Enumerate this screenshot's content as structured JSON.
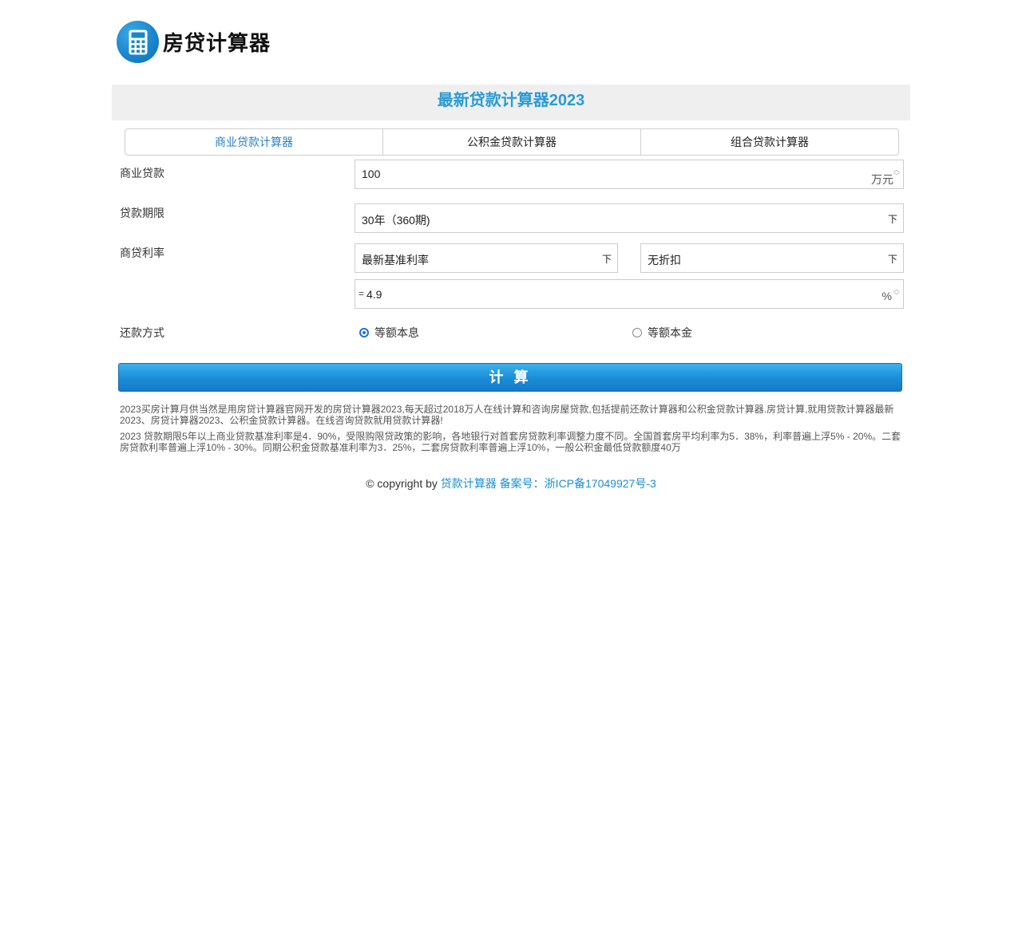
{
  "header": {
    "logo_icon": "calculator-icon",
    "site_title": "房贷计算器"
  },
  "banner": {
    "title": "最新贷款计算器2023"
  },
  "tabs": [
    {
      "label": "商业贷款计算器",
      "active": true
    },
    {
      "label": "公积金贷款计算器",
      "active": false
    },
    {
      "label": "组合贷款计算器",
      "active": false
    }
  ],
  "form": {
    "loan_amount": {
      "label": "商业贷款",
      "value": "100",
      "unit": "万元"
    },
    "loan_term": {
      "label": "贷款期限",
      "value": "30年（360期)",
      "arrow": "下"
    },
    "rate": {
      "label": "商贷利率",
      "rate_type": {
        "value": "最新基准利率",
        "arrow": "下"
      },
      "discount": {
        "value": "无折扣",
        "arrow": "下"
      },
      "prefix": "=",
      "value": "4.9",
      "unit": "%"
    },
    "repayment": {
      "label": "还款方式",
      "options": [
        {
          "label": "等额本息",
          "checked": true
        },
        {
          "label": "等额本金",
          "checked": false
        }
      ]
    }
  },
  "calculate_button": {
    "label": "计 算"
  },
  "description": [
    "2023买房计算月供当然是用房贷计算器官网开发的房贷计算器2023,每天超过2018万人在线计算和咨询房屋贷款,包括提前还款计算器和公积金贷款计算器.房贷计算,就用贷款计算器最新2023、房贷计算器2023、公积金贷款计算器。在线咨询贷款就用贷款计算器!",
    "2023 贷款期限5年以上商业贷款基准利率是4．90%，受限购限贷政策的影响，各地银行对首套房贷款利率调整力度不同。全国首套房平均利率为5．38%，利率普遍上浮5% - 20%。二套房贷款利率普遍上浮10% - 30%。同期公积金贷款基准利率为3．25%，二套房贷款利率普遍上浮10%，一般公积金最低贷款额度40万"
  ],
  "footer": {
    "copyright": "© copyright by",
    "site_link": "贷款计算器",
    "icp": "备案号：浙ICP备17049927号-3"
  }
}
